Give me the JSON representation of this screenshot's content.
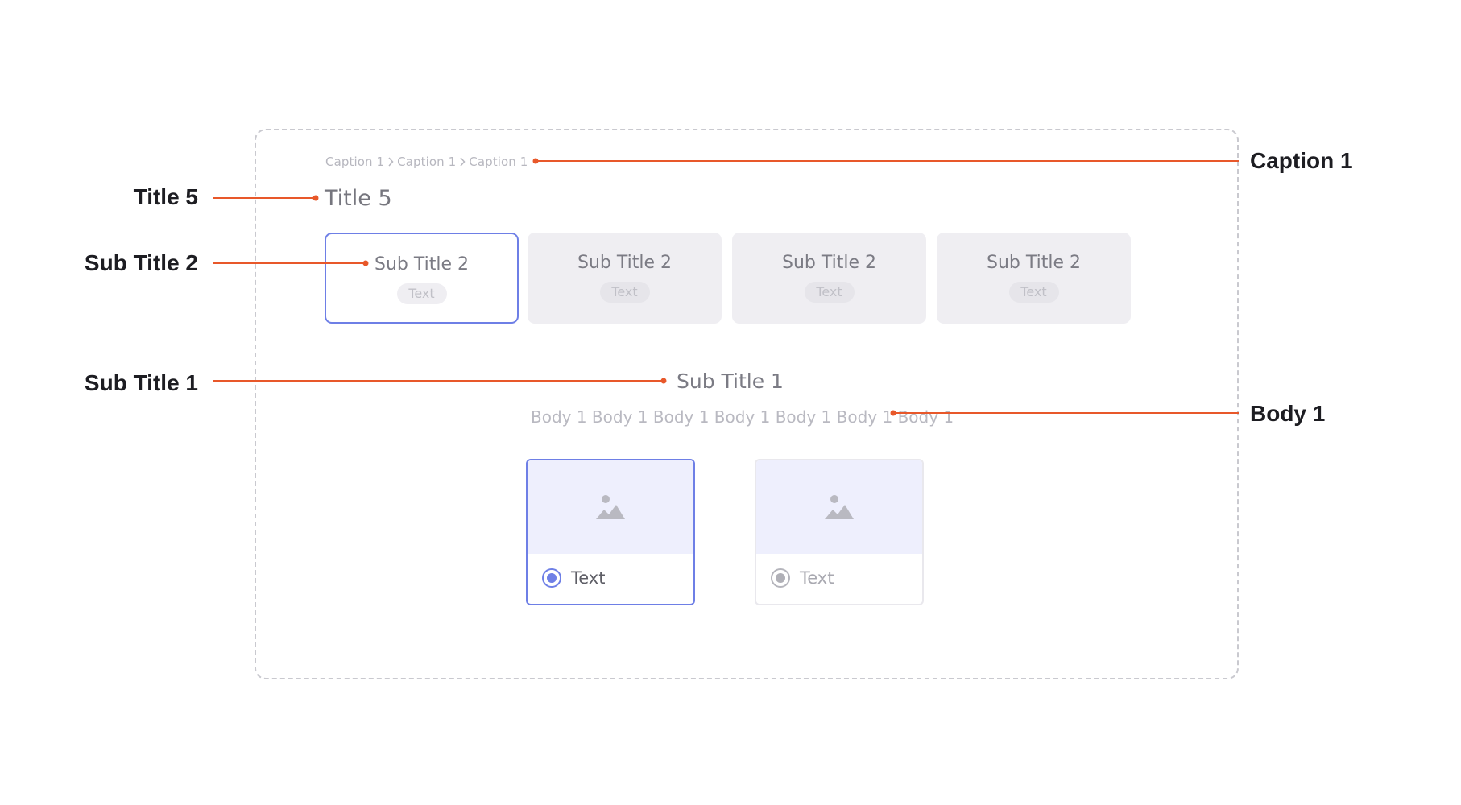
{
  "breadcrumb": {
    "items": [
      "Caption 1",
      "Caption 1",
      "Caption 1"
    ]
  },
  "page_title": "Title 5",
  "tabs": [
    {
      "title": "Sub Title 2",
      "badge": "Text",
      "active": true
    },
    {
      "title": "Sub Title 2",
      "badge": "Text",
      "active": false
    },
    {
      "title": "Sub Title 2",
      "badge": "Text",
      "active": false
    },
    {
      "title": "Sub Title 2",
      "badge": "Text",
      "active": false
    }
  ],
  "section": {
    "title": "Sub Title 1",
    "body": "Body 1 Body 1 Body 1 Body 1 Body 1 Body 1 Body 1"
  },
  "options": [
    {
      "label": "Text",
      "selected": true,
      "icon": "image-placeholder-icon"
    },
    {
      "label": "Text",
      "selected": false,
      "icon": "image-placeholder-icon"
    }
  ],
  "annotations": {
    "caption": "Caption 1",
    "title": "Title 5",
    "sub_title_2": "Sub Title 2",
    "sub_title_1": "Sub Title 1",
    "body": "Body 1"
  },
  "colors": {
    "accent": "#6e7fe6",
    "leader_line": "#e8582a",
    "frame_border": "#c9c9cf"
  }
}
